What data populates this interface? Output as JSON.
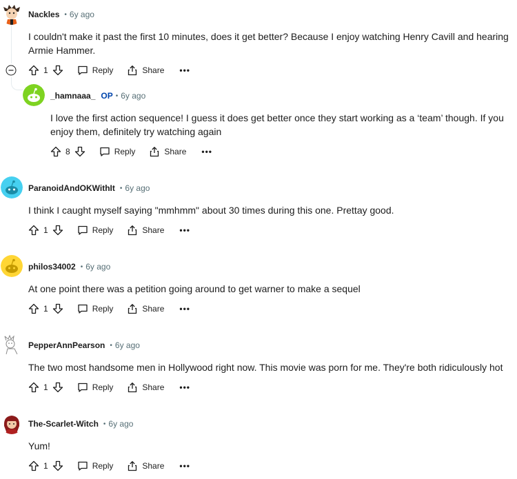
{
  "comments": [
    {
      "author": "Nackles",
      "time": "6y ago",
      "op": "",
      "line1": "I couldn't make it past the first 10 minutes, does it get better? Because I enjoy watching Henry Cavill and hearing",
      "line2": "Armie Hammer.",
      "votes": "1",
      "reply": "Reply",
      "share": "Share"
    },
    {
      "author": "_hamnaaa_",
      "time": "6y ago",
      "op": "OP",
      "line1": "I love the first action sequence! I guess it does get better once they start working as a ‘team’ though. If you",
      "line2": "enjoy them, definitely try watching again",
      "votes": "8",
      "reply": "Reply",
      "share": "Share"
    },
    {
      "author": "ParanoidAndOKWithIt",
      "time": "6y ago",
      "op": "",
      "line1": "I think I caught myself saying \"mmhmm\" about 30 times during this one. Prettay good.",
      "votes": "1",
      "reply": "Reply",
      "share": "Share"
    },
    {
      "author": "philos34002",
      "time": "6y ago",
      "op": "",
      "line1": "At one point there was a petition going around to get warner to make a sequel",
      "votes": "1",
      "reply": "Reply",
      "share": "Share"
    },
    {
      "author": "PepperAnnPearson",
      "time": "6y ago",
      "op": "",
      "line1": "The two most handsome men in Hollywood right now. This movie was porn for me. They're both ridiculously hot",
      "votes": "1",
      "reply": "Reply",
      "share": "Share"
    },
    {
      "author": "The-Scarlet-Witch",
      "time": "6y ago",
      "op": "",
      "line1": "Yum!",
      "votes": "1",
      "reply": "Reply",
      "share": "Share"
    }
  ],
  "separator": "•",
  "more": "•••",
  "colors": {
    "op": "#0045ac",
    "meta": "#576f76",
    "thread": "#e5ebee",
    "avatar_hamnaaa": "#7ed321",
    "avatar_paranoid": "#46d0f0",
    "avatar_philos": "#ffd635"
  }
}
